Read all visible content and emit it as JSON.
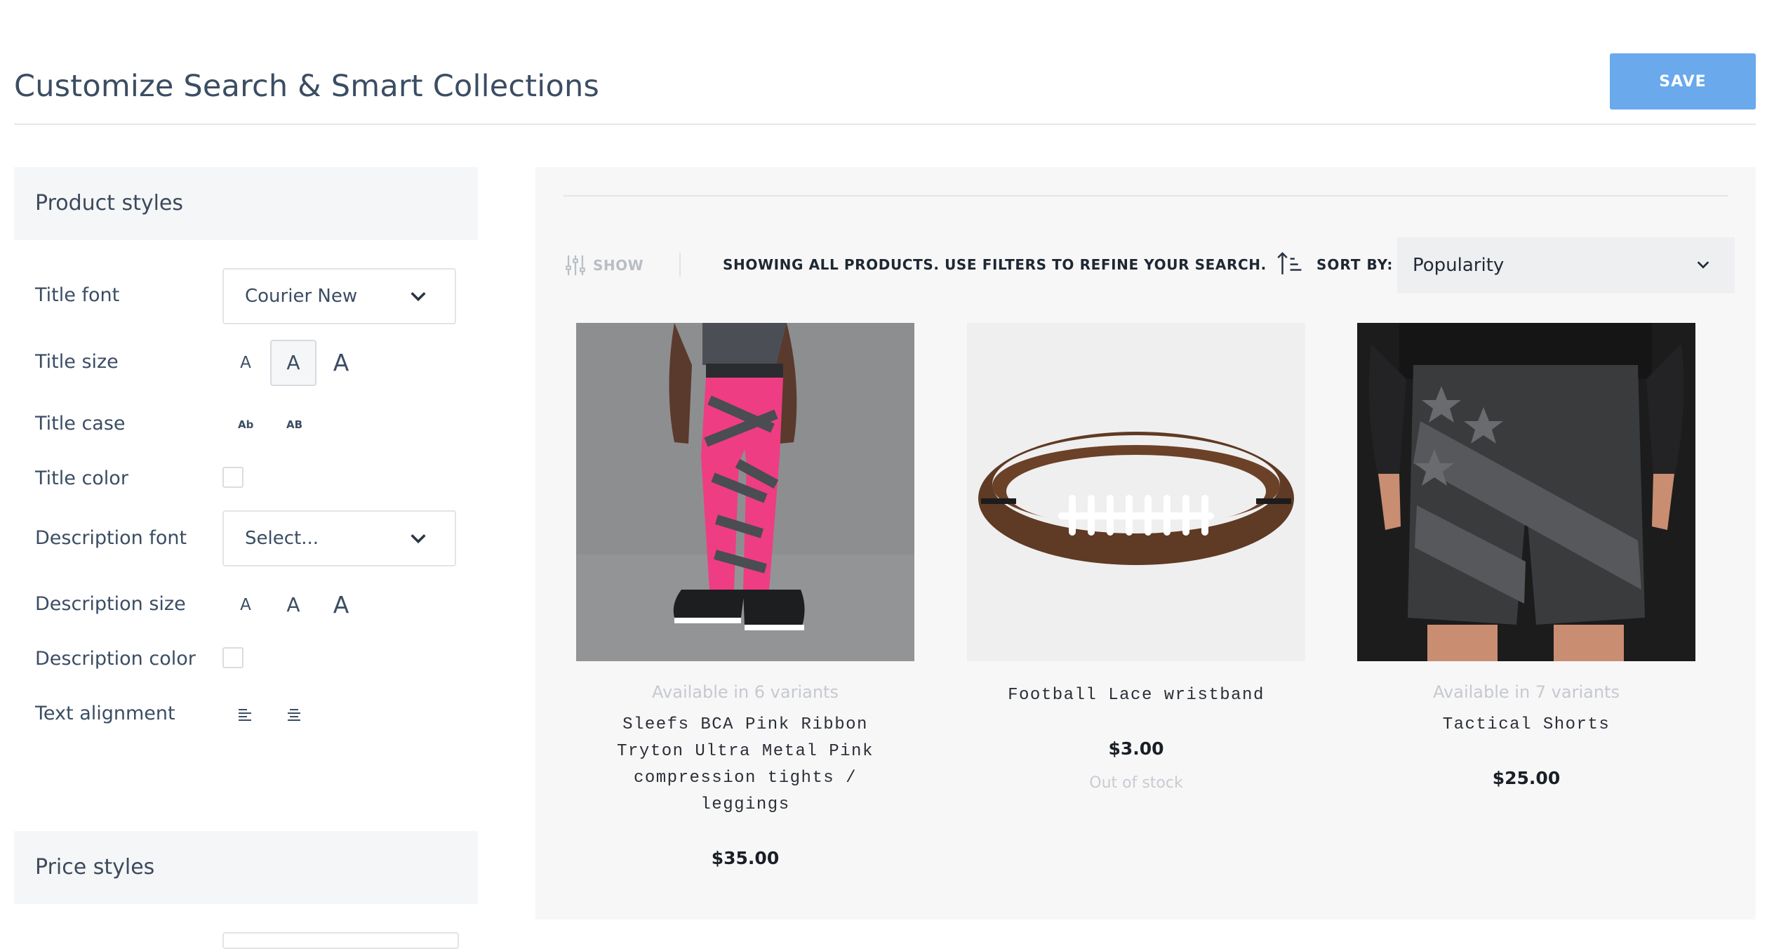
{
  "header": {
    "title": "Customize Search & Smart Collections",
    "save_label": "SAVE"
  },
  "sidebar": {
    "product_styles_heading": "Product styles",
    "rows": {
      "title_font": {
        "label": "Title font",
        "value": "Courier New"
      },
      "title_size": {
        "label": "Title size",
        "options": [
          "A",
          "A",
          "A"
        ],
        "selected": 1
      },
      "title_case": {
        "label": "Title case",
        "options": [
          "Ab",
          "AB"
        ]
      },
      "title_color": {
        "label": "Title color"
      },
      "description_font": {
        "label": "Description font",
        "value": "Select..."
      },
      "description_size": {
        "label": "Description size",
        "options": [
          "A",
          "A",
          "A"
        ]
      },
      "description_color": {
        "label": "Description color"
      },
      "text_alignment": {
        "label": "Text alignment"
      }
    },
    "price_styles_heading": "Price styles"
  },
  "preview": {
    "show_label": "SHOW",
    "status": "SHOWING ALL PRODUCTS. USE FILTERS TO REFINE YOUR SEARCH.",
    "sort_label": "SORT BY:",
    "sort_value": "Popularity",
    "products": [
      {
        "variants": "Available in 6 variants",
        "title": "Sleefs BCA Pink Ribbon Tryton Ultra Metal Pink compression tights / leggings",
        "price": "$35.00",
        "stock": ""
      },
      {
        "variants": "",
        "title": "Football Lace wristband",
        "price": "$3.00",
        "stock": "Out of stock"
      },
      {
        "variants": "Available in 7 variants",
        "title": "Tactical Shorts",
        "price": "$25.00",
        "stock": ""
      }
    ]
  },
  "colors": {
    "save_button": "#69a9ec",
    "panel_bg": "#f5f6f7",
    "preview_bg": "#f7f7f8",
    "leggings_pink": "#ee3d83"
  }
}
